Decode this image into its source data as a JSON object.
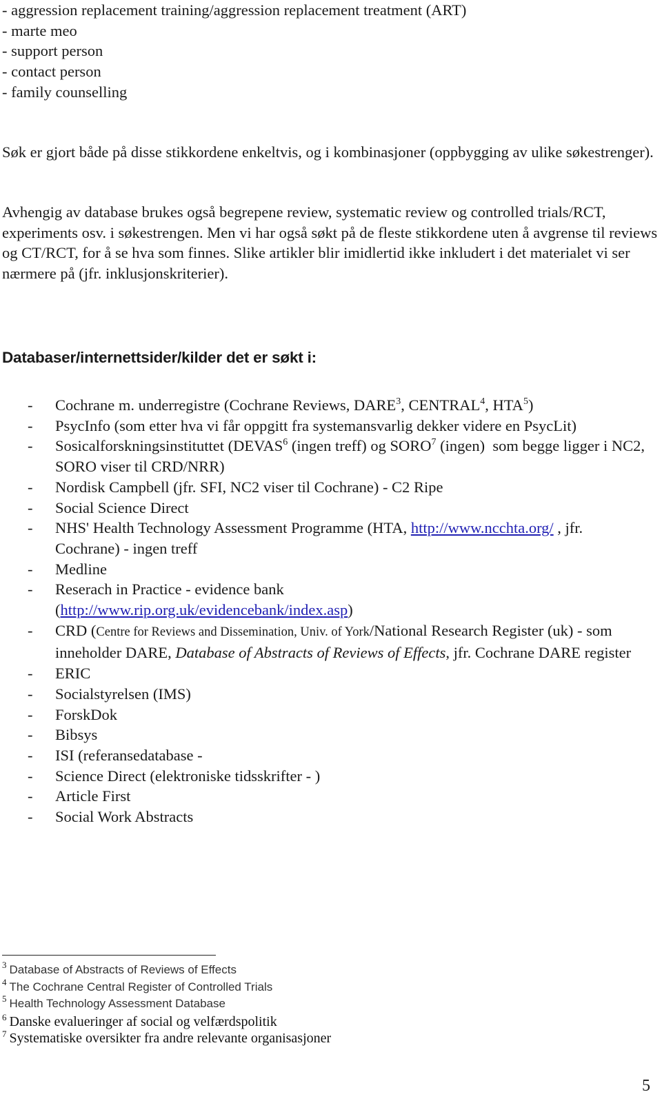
{
  "top_list": [
    "- aggression replacement training/aggression replacement treatment (ART)",
    "- marte meo",
    "- support person",
    "- contact person",
    "- family counselling"
  ],
  "paragraphs": [
    "Søk er gjort både på disse stikkordene enkeltvis, og i kombinasjoner (oppbygging av ulike søkestrenger).",
    "Avhengig av database brukes også begrepene review, systematic review og controlled trials/RCT, experiments osv. i søkestrengen. Men vi har også søkt på de fleste stikkordene uten å avgrense til reviews og CT/RCT, for å se hva som finnes. Slike artikler blir imidlertid ikke inkludert i det materialet vi ser nærmere på (jfr. inklusjonskriterier)."
  ],
  "heading": "Databaser/internettsider/kilder det er søkt i:",
  "bullet_dash": "-",
  "db_list": {
    "cochrane": {
      "pre": "Cochrane m. underregistre (Cochrane Reviews, DARE",
      "sup1": "3",
      "mid1": ", CENTRAL",
      "sup2": "4",
      "mid2": ", HTA",
      "sup3": "5",
      "post": ")"
    },
    "psycinfo": "PsycInfo (som etter hva vi får oppgitt fra systemansvarlig  dekker videre en PsycLit)",
    "sosical": {
      "pre": "Sosicalforskningsinstituttet (DEVAS",
      "sup1": "6",
      "mid": " (ingen treff) og SORO",
      "sup2": "7",
      "post": " (ingen)  som begge ligger i NC2, SORO viser til CRD/NRR)"
    },
    "nordisk": "Nordisk Campbell (jfr. SFI, NC2 viser til Cochrane) - C2 Ripe",
    "social_science_direct": "Social Science Direct",
    "nhs": {
      "pre": "NHS' Health Technology Assessment Programme (HTA, ",
      "link": "http://www.ncchta.org/",
      "post": " , jfr. Cochrane) - ingen treff"
    },
    "medline": "Medline",
    "rip": {
      "pre": "Reserach in Practice - evidence bank (",
      "link": "http://www.rip.org.uk/evidencebank/index.asp",
      "post": ")"
    },
    "crd": {
      "pre": "CRD (",
      "small": "Centre for Reviews and Dissemination, Univ. of York",
      "mid": "/National Research Register (uk) - som inneholder DARE, ",
      "italic": "Database of Abstracts of Reviews of Effects",
      "post": ", jfr. Cochrane DARE register"
    },
    "simple_items": [
      "ERIC",
      "Socialstyrelsen (IMS)",
      "ForskDok",
      "Bibsys",
      "ISI (referansedatabase -",
      "Science Direct (elektroniske tidsskrifter - )",
      "Article First",
      "Social Work Abstracts"
    ]
  },
  "footnotes": [
    {
      "num": "3",
      "text": "Database of Abstracts of Reviews of Effects"
    },
    {
      "num": "4",
      "text": "The Cochrane Central Register of Controlled Trials"
    },
    {
      "num": "5",
      "text": "Health Technology Assessment Database"
    },
    {
      "num": "6",
      "text": "Danske evalueringer af social og velfærdspolitik"
    },
    {
      "num": "7",
      "text": "Systematiske oversikter fra andre relevante organisasjoner"
    }
  ],
  "page_number": "5",
  "colors": {
    "link": "#1f1fb3",
    "text": "#1a1a1a"
  }
}
